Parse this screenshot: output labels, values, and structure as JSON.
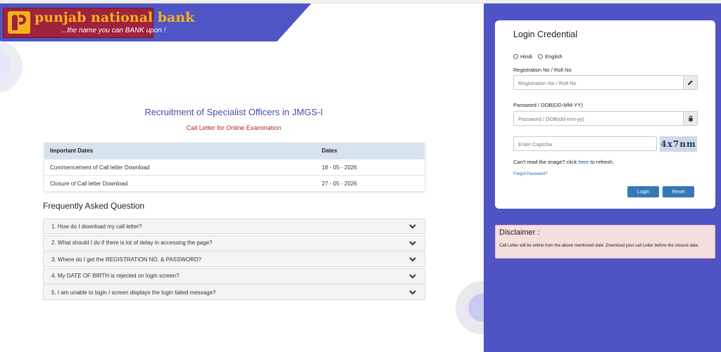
{
  "header": {
    "bank_name": "punjab national bank",
    "tagline": "...the name you can BANK upon !"
  },
  "main": {
    "title": "Recruitment of Specialist Officers in JMGS-I",
    "subtitle": "Call Letter for Online Examination",
    "table": {
      "headers": [
        "Important Dates",
        "Dates"
      ],
      "rows": [
        [
          "Commencement of Call letter Download",
          "18 - 05 - 2026"
        ],
        [
          "Closure of Call letter Download",
          "27 - 05 - 2026"
        ]
      ]
    },
    "faq_title": "Frequently Asked Question",
    "faq": [
      "1. How do I download my call letter?",
      "2. What should I do if there is lot of delay in accessing the page?",
      "3. Where do I get the REGISTRATION NO. & PASSWORD?",
      "4. My DATE OF BIRTH is rejected on login screen?",
      "5. I am unable to login / screen displays the login failed message?"
    ]
  },
  "login": {
    "title": "Login Credential",
    "lang_hindi": "Hindi",
    "lang_english": "English",
    "reg_label": "Registration No / Roll No",
    "reg_placeholder": "Registration No / Roll No",
    "pwd_label": "Password / DOB(DD-MM-YY)",
    "pwd_placeholder": "Password / DOB(dd-mm-yy)",
    "captcha_placeholder": "Enter Captcha",
    "captcha_text": "4x7nm",
    "cant_read_prefix": "Can't read the image? click ",
    "cant_read_link": "here",
    "cant_read_suffix": " to refresh.",
    "forgot": "Forgot Password?",
    "login_btn": "Login",
    "reset_btn": "Reset"
  },
  "disclaimer": {
    "title": "Disclaimer :",
    "text": "Call Letter will be online from the above mentioned date. Download your call Letter before the closure date."
  },
  "colors": {
    "brand_purple": "#4f53c4",
    "brand_maroon": "#a0223c",
    "brand_gold": "#f6b21b",
    "button_blue": "#3578b7"
  }
}
